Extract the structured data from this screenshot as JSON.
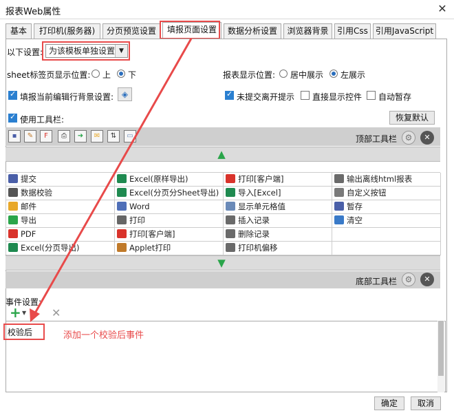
{
  "window": {
    "title": "报表Web属性",
    "close": "✕"
  },
  "tabs": [
    "基本",
    "打印机(服务器)",
    "分页预览设置",
    "填报页面设置",
    "数据分析设置",
    "浏览器背景",
    "引用Css",
    "引用JavaScript"
  ],
  "settings": {
    "scope_label": "以下设置:",
    "scope_value": "为该模板单独设置",
    "sheet_pos_label": "sheet标签页显示位置:",
    "sheet_pos_top": "上",
    "sheet_pos_bottom": "下",
    "report_pos_label": "报表显示位置:",
    "report_pos_center": "居中展示",
    "report_pos_left": "左展示",
    "fill_row_bg_label": "填报当前编辑行背景设置:",
    "unsubmitted_prompt_label": "未提交离开提示",
    "direct_show_control_label": "直接显示控件",
    "auto_save_label": "自动暂存",
    "use_toolbar_label": "使用工具栏:",
    "restore_default": "恢复默认"
  },
  "toolbar": {
    "top_label": "顶部工具栏",
    "bottom_label": "底部工具栏"
  },
  "tool_grid": {
    "rows": [
      [
        {
          "label": "提交",
          "icon": "save-icon",
          "color": "#4a5fa8"
        },
        {
          "label": "Excel(原样导出)",
          "icon": "excel-icon",
          "color": "#1f8a50"
        },
        {
          "label": "打印[客户端]",
          "icon": "pdf-print-icon",
          "color": "#d9332b"
        },
        {
          "label": "输出离线html报表",
          "icon": "html-export-icon",
          "color": "#6a6a6a"
        }
      ],
      [
        {
          "label": "数据校验",
          "icon": "validate-icon",
          "color": "#555555"
        },
        {
          "label": "Excel(分页分Sheet导出)",
          "icon": "excel-icon",
          "color": "#1f8a50"
        },
        {
          "label": "导入[Excel]",
          "icon": "excel-import-icon",
          "color": "#1f8a50"
        },
        {
          "label": "自定义按钮",
          "icon": "gear-icon",
          "color": "#7a7a7a"
        }
      ],
      [
        {
          "label": "邮件",
          "icon": "mail-icon",
          "color": "#e8a82a"
        },
        {
          "label": "Word",
          "icon": "word-icon",
          "color": "#4f6fb8"
        },
        {
          "label": "显示单元格值",
          "icon": "cell-value-icon",
          "color": "#6a8ab8"
        },
        {
          "label": "暂存",
          "icon": "save-icon",
          "color": "#4a5fa8"
        }
      ],
      [
        {
          "label": "导出",
          "icon": "export-icon",
          "color": "#2aa54a"
        },
        {
          "label": "打印",
          "icon": "print-icon",
          "color": "#666666"
        },
        {
          "label": "插入记录",
          "icon": "insert-row-icon",
          "color": "#6a6a6a"
        },
        {
          "label": "清空",
          "icon": "eraser-icon",
          "color": "#3a7ac8"
        }
      ],
      [
        {
          "label": "PDF",
          "icon": "pdf-icon",
          "color": "#d9332b"
        },
        {
          "label": "打印[客户端]",
          "icon": "flash-print-icon",
          "color": "#d9332b"
        },
        {
          "label": "删除记录",
          "icon": "delete-row-icon",
          "color": "#6a6a6a"
        },
        {
          "label": "",
          "icon": "",
          "color": "#ffffff"
        }
      ],
      [
        {
          "label": "Excel(分页导出)",
          "icon": "excel-icon",
          "color": "#1f8a50"
        },
        {
          "label": "Applet打印",
          "icon": "applet-print-icon",
          "color": "#c07a2a"
        },
        {
          "label": "打印机偏移",
          "icon": "printer-offset-icon",
          "color": "#6a6a6a"
        },
        {
          "label": "",
          "icon": "",
          "color": "#ffffff"
        }
      ]
    ]
  },
  "events": {
    "label": "事件设置:",
    "add": "+",
    "remove": "✕",
    "items": [
      "校验后"
    ],
    "annotation": "添加一个校验后事件"
  },
  "footer": {
    "ok": "确定",
    "cancel": "取消"
  },
  "colors": {
    "accent": "#2a7fd0",
    "annotation": "#e84a4a",
    "green": "#2aa54a"
  }
}
